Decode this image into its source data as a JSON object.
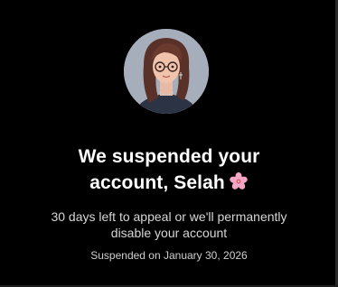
{
  "profile": {
    "avatar_alt": "profile-avatar"
  },
  "notice": {
    "title_line1": "We suspended your",
    "title_line2": "account, Selah",
    "title_emoji": "cherry-blossom-icon",
    "subtitle_line1": "30 days left to appeal or we'll permanently",
    "subtitle_line2": "disable your account",
    "suspended_on": "Suspended on January 30, 2026"
  },
  "colors": {
    "background": "#000000",
    "title": "#ffffff",
    "subtitle": "#d6d6d6",
    "blossom": "#f3a6c4"
  }
}
